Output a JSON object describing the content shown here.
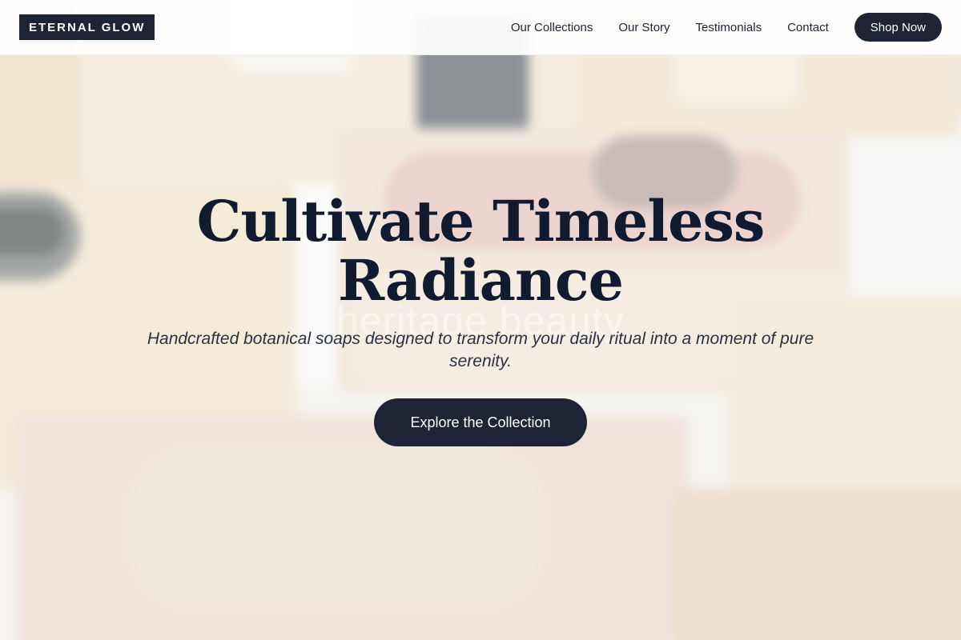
{
  "header": {
    "logo": "ETERNAL GLOW",
    "nav": [
      {
        "label": "Our Collections"
      },
      {
        "label": "Our Story"
      },
      {
        "label": "Testimonials"
      },
      {
        "label": "Contact"
      }
    ],
    "shop_label": "Shop Now"
  },
  "hero": {
    "title_line1": "Cultivate Timeless",
    "title_line2": "Radiance",
    "watermark": "heritage beauty",
    "subtitle_line1": "Handcrafted botanical soaps designed to transform your daily ritual into a moment of pure",
    "subtitle_line2": "serenity.",
    "cta_label": "Explore the Collection",
    "background_image": "soap-bars-image"
  },
  "colors": {
    "primary": "#1e2433",
    "title": "#111a2e",
    "subtitle": "#2a3142"
  }
}
